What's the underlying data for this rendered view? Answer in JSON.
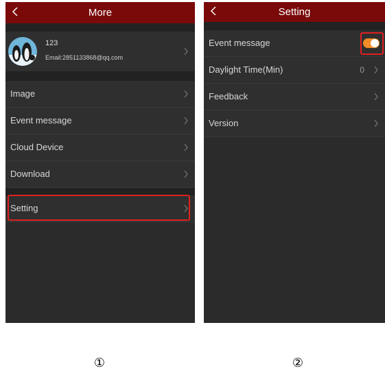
{
  "screen1": {
    "title": "More",
    "profile": {
      "name": "123",
      "email": "Email:2851133868@qq.com"
    },
    "menu": [
      {
        "label": "Image"
      },
      {
        "label": "Event message"
      },
      {
        "label": "Cloud Device"
      },
      {
        "label": "Download"
      }
    ],
    "setting_label": "Setting"
  },
  "screen2": {
    "title": "Setting",
    "rows": [
      {
        "label": "Event message",
        "toggle_on": true
      },
      {
        "label": "Daylight Time(Min)",
        "value": "0"
      },
      {
        "label": "Feedback"
      },
      {
        "label": "Version"
      }
    ]
  },
  "captions": [
    "①",
    "②"
  ],
  "colors": {
    "titlebar": "#7a0a0a",
    "toggle_on": "#f28c28",
    "highlight": "#e02020"
  }
}
